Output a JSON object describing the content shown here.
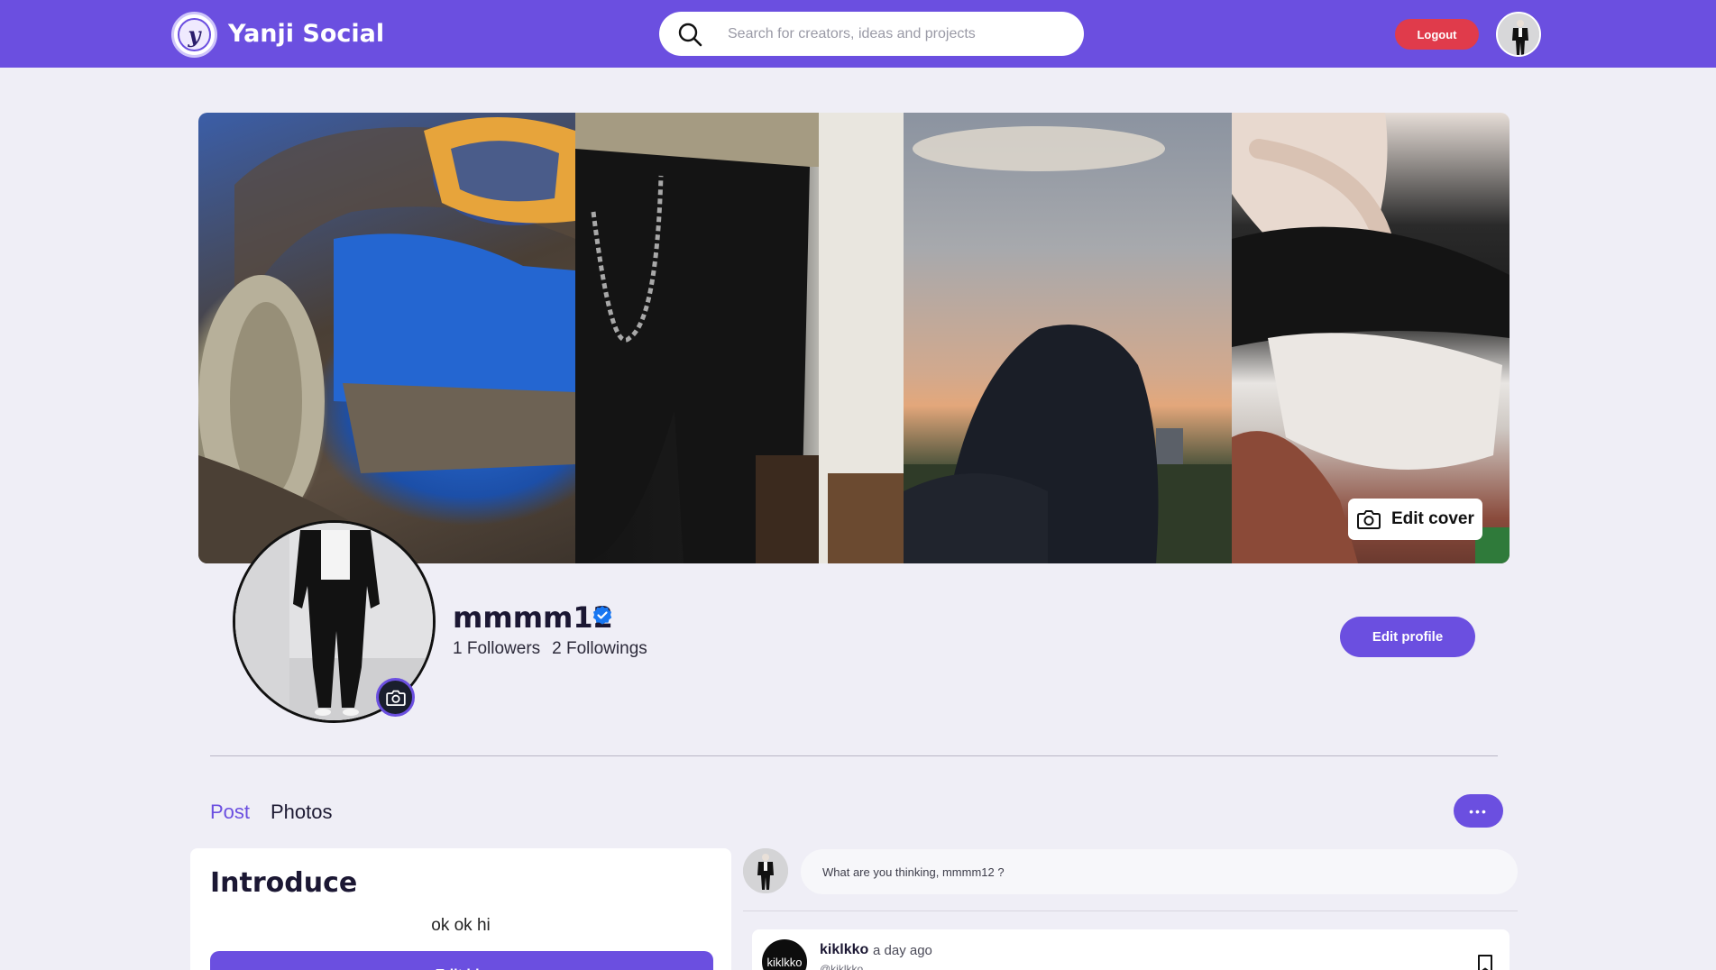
{
  "app": {
    "brand_name": "Yanji Social",
    "logo_letter": "y",
    "accent_color": "#6b4fe0",
    "logout_color": "#e03b4b"
  },
  "header": {
    "search_placeholder": "Search for creators, ideas and projects",
    "logout_label": "Logout"
  },
  "cover": {
    "edit_cover_label": "Edit cover"
  },
  "profile": {
    "username": "mmmm12",
    "verified": true,
    "followers_text": "1 Followers",
    "followings_text": "2 Followings",
    "edit_profile_label": "Edit profile"
  },
  "tabs": [
    {
      "label": "Post",
      "active": true
    },
    {
      "label": "Photos",
      "active": false
    }
  ],
  "more_button_label": "•••",
  "introduce": {
    "title": "Introduce",
    "bio": "ok ok hi",
    "edit_button_label": "Edit bio"
  },
  "composer": {
    "placeholder": "What are you thinking, mmmm12 ?"
  },
  "post": {
    "author": "kiklkko",
    "avatar_text": "kiklkko",
    "time": "a day ago",
    "handle": "@kiklkko"
  }
}
